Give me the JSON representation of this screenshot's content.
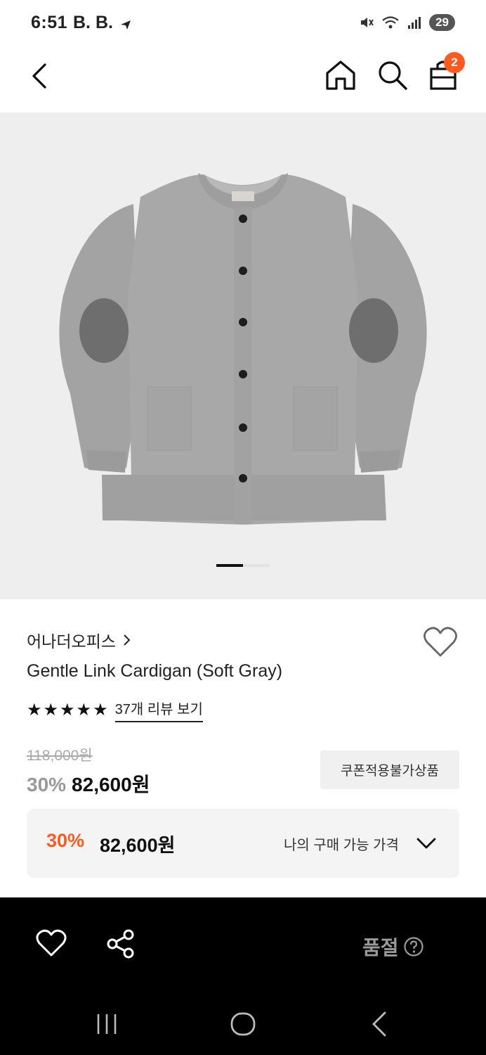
{
  "status_bar": {
    "time": "6:51",
    "notifications": "B. B.",
    "battery": "29"
  },
  "nav": {
    "cart_count": "2"
  },
  "product": {
    "brand": "어나더오피스",
    "name": "Gentle Link Cardigan (Soft Gray)",
    "rating_stars": 5,
    "review_link": "37개 리뷰 보기",
    "original_price": "118,000원",
    "discount": "30%",
    "sale_price": "82,600원",
    "coupon_badge": "쿠폰적용불가상품"
  },
  "my_price": {
    "discount": "30%",
    "price": "82,600원",
    "label": "나의 구매 가능 가격"
  },
  "bottom_bar": {
    "status": "품절"
  },
  "colors": {
    "accent": "#ff5a1f",
    "image_bg": "#eeeeee",
    "bottom_bar_bg": "#000000"
  }
}
